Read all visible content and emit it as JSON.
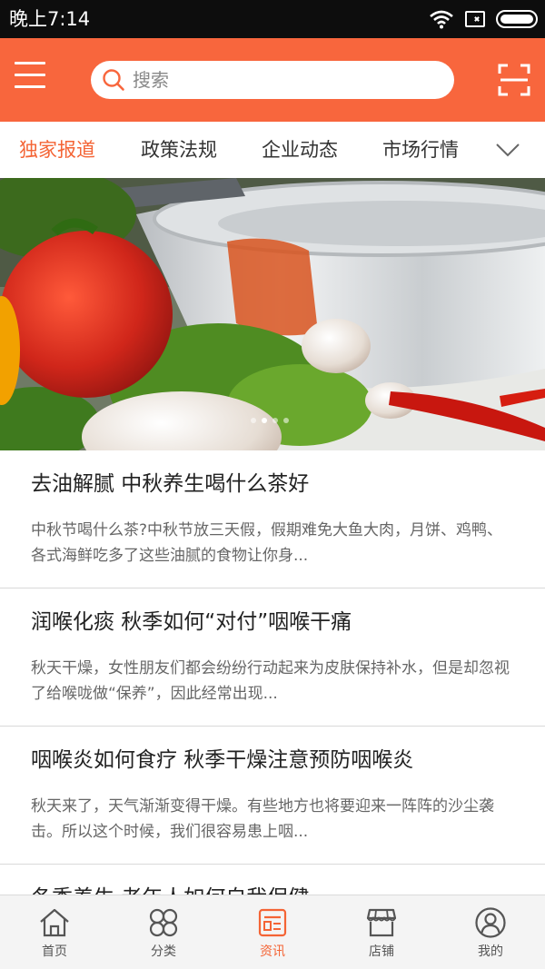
{
  "status_bar": {
    "time": "晚上7:14",
    "icons": [
      "wifi-icon",
      "sim-icon",
      "battery-icon"
    ]
  },
  "header": {
    "menu_icon": "hamburger-menu-icon",
    "search": {
      "placeholder": "搜索",
      "value": ""
    },
    "scan_icon": "scan-icon",
    "background_color": "#f8663d"
  },
  "tabs": {
    "items": [
      {
        "label": "独家报道",
        "active": true
      },
      {
        "label": "政策法规",
        "active": false
      },
      {
        "label": "企业动态",
        "active": false
      },
      {
        "label": "市场行情",
        "active": false
      }
    ],
    "more_icon": "chevron-down-icon",
    "active_color": "#f46435"
  },
  "banner": {
    "slide_count": 4,
    "active_slide": 2
  },
  "news": [
    {
      "title": "去油解腻 中秋养生喝什么茶好",
      "summary": "中秋节喝什么茶?中秋节放三天假，假期难免大鱼大肉，月饼、鸡鸭、各式海鲜吃多了这些油腻的食物让你身..."
    },
    {
      "title": "润喉化痰 秋季如何“对付”咽喉干痛",
      "summary": "秋天干燥，女性朋友们都会纷纷行动起来为皮肤保持补水，但是却忽视了给喉咙做“保养”，因此经常出现..."
    },
    {
      "title": "咽喉炎如何食疗 秋季干燥注意预防咽喉炎",
      "summary": "秋天来了，天气渐渐变得干燥。有些地方也将要迎来一阵阵的沙尘袭击。所以这个时候，我们很容易患上咽..."
    },
    {
      "title": "冬季养生 老年人如何自我保健",
      "summary": ""
    }
  ],
  "bottom_nav": {
    "items": [
      {
        "label": "首页",
        "icon": "home-icon",
        "active": false
      },
      {
        "label": "分类",
        "icon": "category-icon",
        "active": false
      },
      {
        "label": "资讯",
        "icon": "news-icon",
        "active": true
      },
      {
        "label": "店铺",
        "icon": "store-icon",
        "active": false
      },
      {
        "label": "我的",
        "icon": "profile-icon",
        "active": false
      }
    ]
  }
}
